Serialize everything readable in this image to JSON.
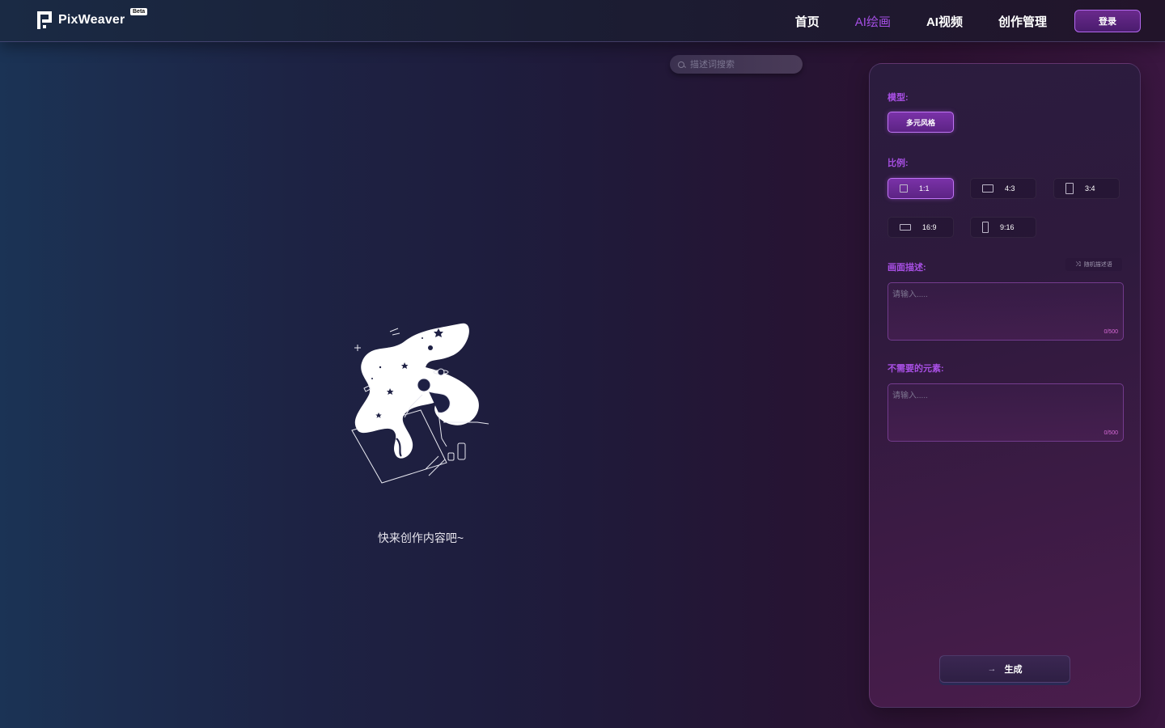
{
  "header": {
    "brand": "PixWeaver",
    "badge": "Beta",
    "nav": [
      "首页",
      "AI绘画",
      "AI视频",
      "创作管理"
    ],
    "active_nav": "AI绘画",
    "login_label": "登录"
  },
  "search": {
    "placeholder": "描述词搜索"
  },
  "empty_state": {
    "message": "快来创作内容吧~"
  },
  "panel": {
    "model_label": "模型:",
    "model_option": "多元风格",
    "ratio_label": "比例:",
    "ratios": [
      "1:1",
      "4:3",
      "3:4",
      "16:9",
      "9:16"
    ],
    "selected_ratio": "1:1",
    "description_label": "画面描述:",
    "random_label": "随机描述语",
    "description_placeholder": "请输入.....",
    "description_counter": "0/500",
    "negative_label": "不需要的元素:",
    "negative_placeholder": "请输入.....",
    "negative_counter": "0/500",
    "generate_label": "生成"
  },
  "colors": {
    "accent": "#a64fe6",
    "counter": "#d86ad8"
  }
}
